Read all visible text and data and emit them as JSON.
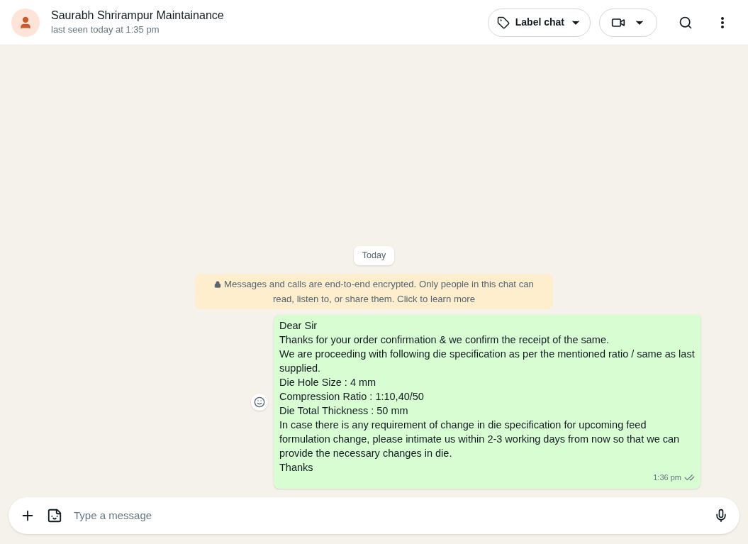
{
  "header": {
    "name": "Saurabh Shrirampur Maintainance",
    "status": "last seen today at 1:35 pm",
    "label_button": "Label chat"
  },
  "date_divider": "Today",
  "encryption_notice": "Messages and calls are end-to-end encrypted. Only people in this chat can read, listen to, or share them. Click to learn more",
  "messages": [
    {
      "lines": [
        "Dear Sir",
        "Thanks for your order confirmation & we confirm the receipt of the same.",
        "We are proceeding with following die specification as per the mentioned ratio / same as last supplied.",
        "Die Hole Size : 4 mm",
        "Compression Ratio : 1:10,40/50",
        "Die Total Thickness : 50 mm",
        "In case there is any requirement of change in die specification for upcoming feed formulation change, please intimate us within 2-3 working days from now so that we can provide the necessary changes in die.",
        "Thanks"
      ],
      "time": "1:36 pm",
      "read": false
    }
  ],
  "composer": {
    "placeholder": "Type a message"
  }
}
